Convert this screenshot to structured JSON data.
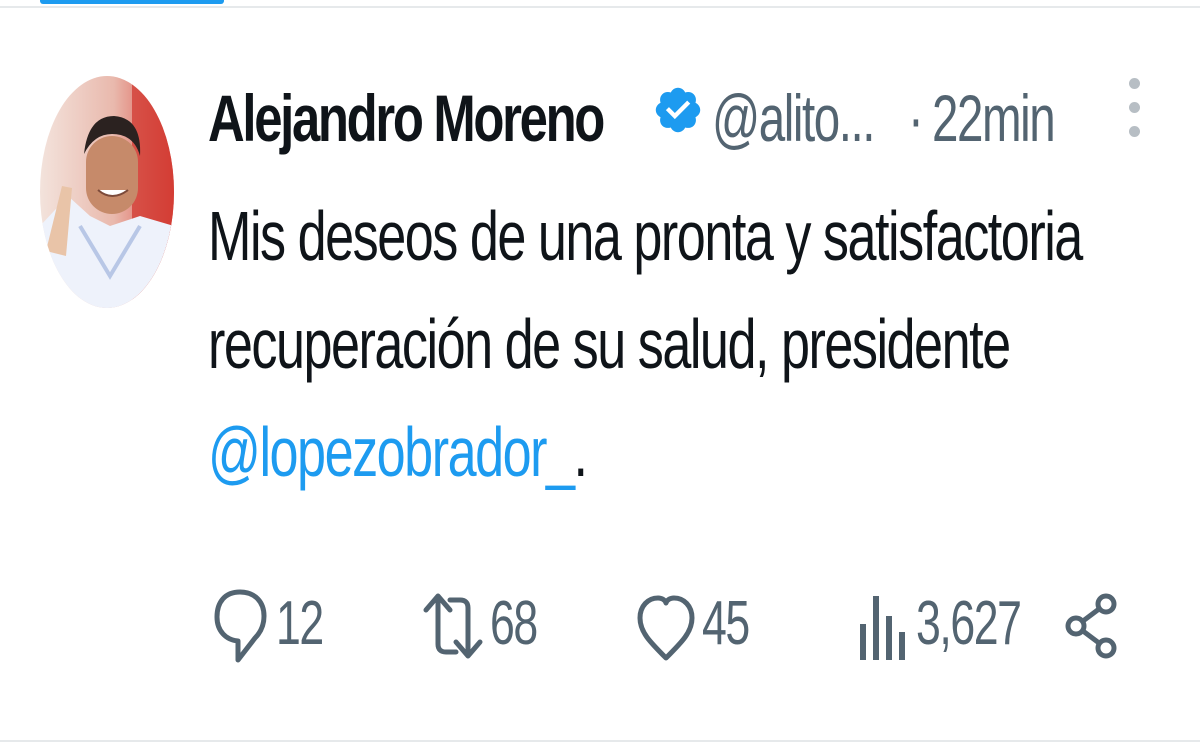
{
  "tweet": {
    "author_name": "Alejandro Moreno",
    "handle": "@alito...",
    "separator": "·",
    "time": "22min",
    "body_lines": [
      "Mis deseos de una pronta y satisfactoria",
      "recuperación de su salud, presidente"
    ],
    "mention": "@lopezobrador_",
    "mention_suffix": ".",
    "verified": true
  },
  "actions": {
    "replies": "12",
    "retweets": "68",
    "likes": "45",
    "views": "3,627"
  },
  "icons": [
    "verified-badge-icon",
    "more-options-icon",
    "reply-icon",
    "retweet-icon",
    "like-icon",
    "views-icon",
    "share-icon"
  ],
  "colors": {
    "accent": "#1d9bf0",
    "text": "#0f1419",
    "muted": "#536471"
  }
}
